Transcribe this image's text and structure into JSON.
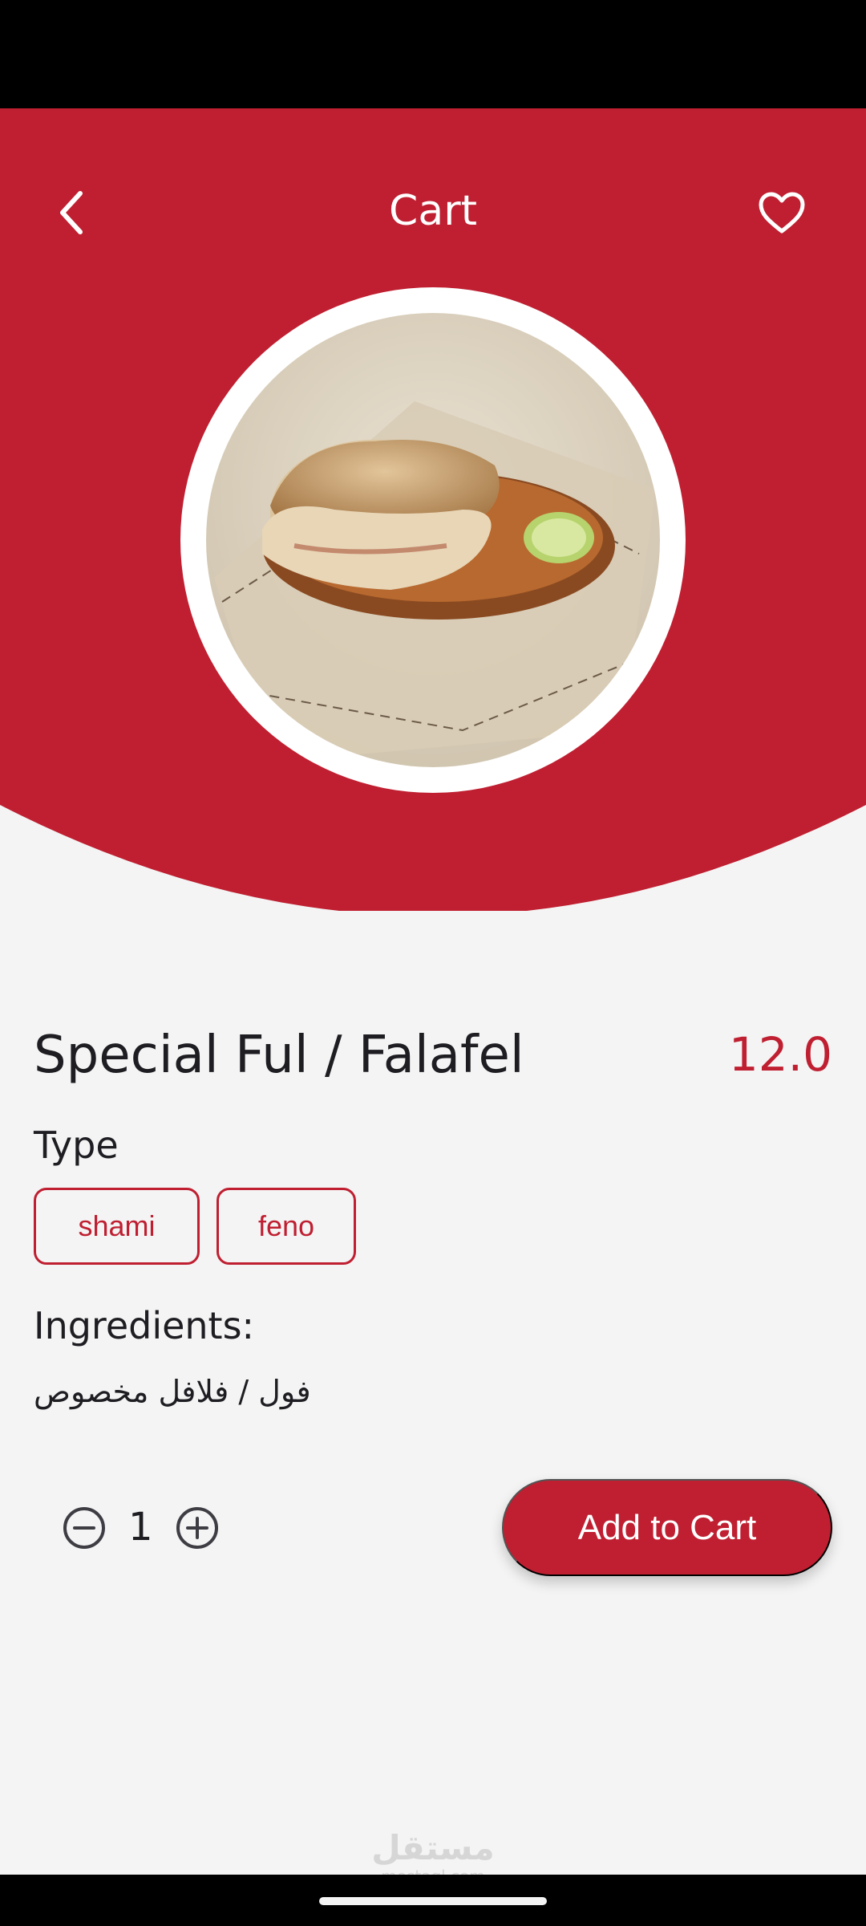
{
  "header": {
    "title": "Cart",
    "back_icon": "chevron-left-icon",
    "favorite_icon": "heart-outline-icon"
  },
  "colors": {
    "primary": "#bf1f31",
    "background": "#f4f4f4",
    "text": "#1d1d22"
  },
  "product": {
    "name": "Special Ful / Falafel",
    "price": "12.0",
    "image": "food-image"
  },
  "type_section": {
    "label": "Type",
    "options": [
      "shami",
      "feno"
    ]
  },
  "ingredients": {
    "label": "Ingredients:",
    "text": "فول / فلافل مخصوص"
  },
  "quantity": {
    "value": "1",
    "minus_icon": "minus-circle-icon",
    "plus_icon": "plus-circle-icon"
  },
  "actions": {
    "add_to_cart": "Add to Cart"
  },
  "watermark": {
    "arabic": "مستقل",
    "latin": "mostaql.com"
  }
}
